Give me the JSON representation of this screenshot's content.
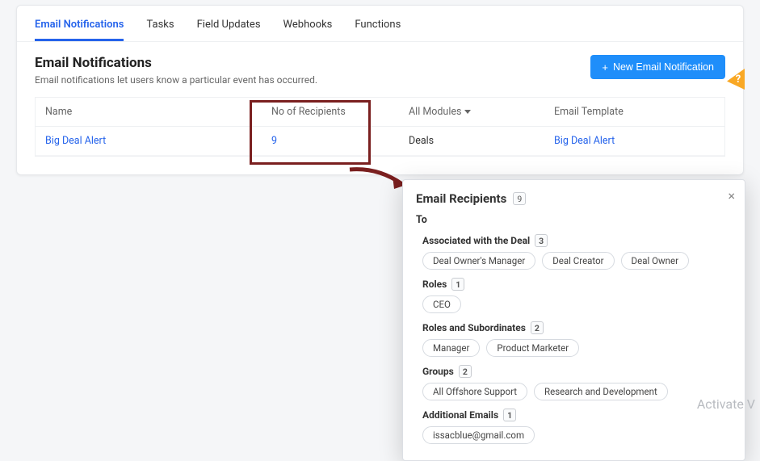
{
  "tabs": [
    "Email Notifications",
    "Tasks",
    "Field Updates",
    "Webhooks",
    "Functions"
  ],
  "activeTabIndex": 0,
  "section": {
    "title": "Email Notifications",
    "subtitle": "Email notifications let users know a particular event has occurred.",
    "newButton": "New Email Notification"
  },
  "columns": {
    "name": "Name",
    "recipients": "No of Recipients",
    "module": "All Modules",
    "template": "Email Template"
  },
  "rows": [
    {
      "name": "Big Deal Alert",
      "recipients": "9",
      "module": "Deals",
      "template": "Big Deal Alert"
    }
  ],
  "helpGlyph": "?",
  "popup": {
    "title": "Email Recipients",
    "total": "9",
    "toLabel": "To",
    "groups": [
      {
        "title": "Associated with the Deal",
        "count": "3",
        "chips": [
          "Deal Owner's Manager",
          "Deal Creator",
          "Deal Owner"
        ]
      },
      {
        "title": "Roles",
        "count": "1",
        "chips": [
          "CEO"
        ]
      },
      {
        "title": "Roles and Subordinates",
        "count": "2",
        "chips": [
          "Manager",
          "Product Marketer"
        ]
      },
      {
        "title": "Groups",
        "count": "2",
        "chips": [
          "All Offshore Support",
          "Research and Development"
        ]
      },
      {
        "title": "Additional Emails",
        "count": "1",
        "chips": [
          "issacblue@gmail.com"
        ]
      }
    ]
  },
  "watermark": "Activate V"
}
